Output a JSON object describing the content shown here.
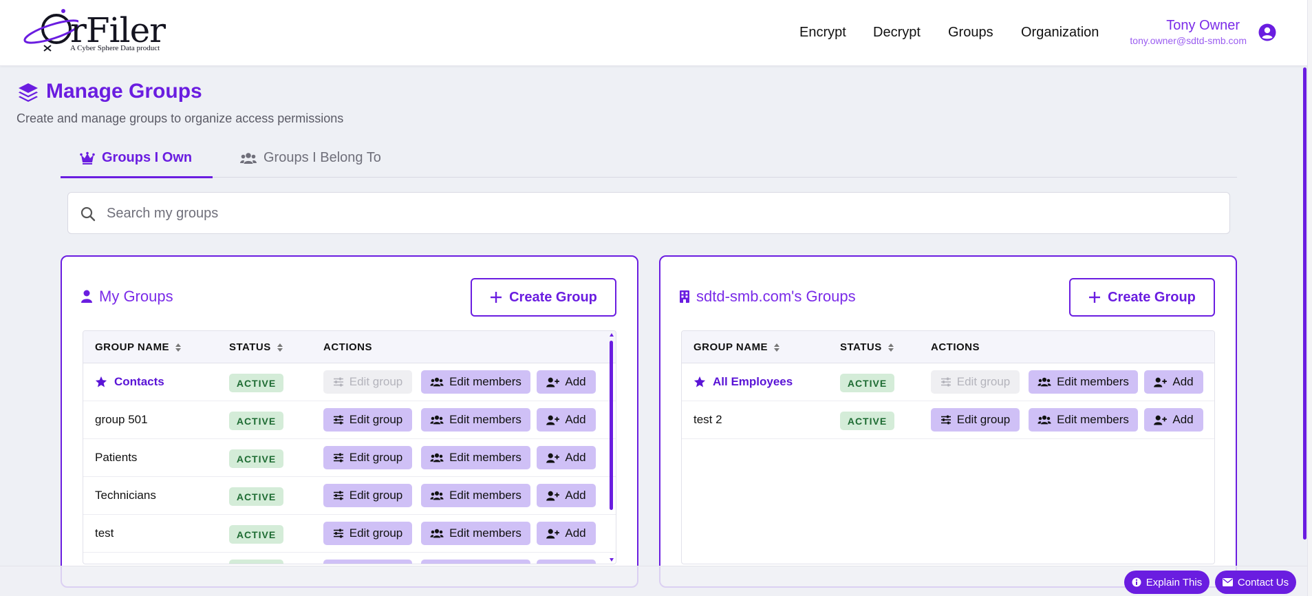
{
  "brand": {
    "logo_text": "rFiler",
    "logo_sub": "A Cyber Sphere Data product"
  },
  "nav": {
    "items": [
      "Encrypt",
      "Decrypt",
      "Groups",
      "Organization"
    ]
  },
  "user": {
    "name": "Tony Owner",
    "email": "tony.owner@sdtd-smb.com"
  },
  "page": {
    "title": "Manage Groups",
    "subtitle": "Create and manage groups to organize access permissions"
  },
  "tabs": [
    {
      "label": "Groups I Own",
      "icon": "crown-icon",
      "active": true
    },
    {
      "label": "Groups I Belong To",
      "icon": "users-icon",
      "active": false
    }
  ],
  "search": {
    "placeholder": "Search my groups",
    "value": ""
  },
  "panels": {
    "my_groups": {
      "title": "My Groups",
      "create_label": "Create Group",
      "columns": [
        "GROUP NAME",
        "STATUS",
        "ACTIONS"
      ],
      "rows": [
        {
          "name": "Contacts",
          "primary": true,
          "status": "ACTIVE",
          "edit_disabled": true
        },
        {
          "name": "group 501",
          "primary": false,
          "status": "ACTIVE",
          "edit_disabled": false
        },
        {
          "name": "Patients",
          "primary": false,
          "status": "ACTIVE",
          "edit_disabled": false
        },
        {
          "name": "Technicians",
          "primary": false,
          "status": "ACTIVE",
          "edit_disabled": false
        },
        {
          "name": "test",
          "primary": false,
          "status": "ACTIVE",
          "edit_disabled": false
        }
      ]
    },
    "org_groups": {
      "title": "sdtd-smb.com's Groups",
      "create_label": "Create Group",
      "columns": [
        "GROUP NAME",
        "STATUS",
        "ACTIONS"
      ],
      "rows": [
        {
          "name": "All Employees",
          "primary": true,
          "status": "ACTIVE",
          "edit_disabled": true
        },
        {
          "name": "test 2",
          "primary": false,
          "status": "ACTIVE",
          "edit_disabled": false
        }
      ]
    }
  },
  "actions": {
    "edit_group": "Edit group",
    "edit_members": "Edit members",
    "add": "Add"
  },
  "footer": {
    "explain": "Explain This",
    "contact": "Contact Us"
  },
  "colors": {
    "accent": "#6a1de0",
    "button_bg": "#cfc0f6",
    "badge_bg": "#d4ecd8",
    "badge_text": "#1d6b32"
  }
}
